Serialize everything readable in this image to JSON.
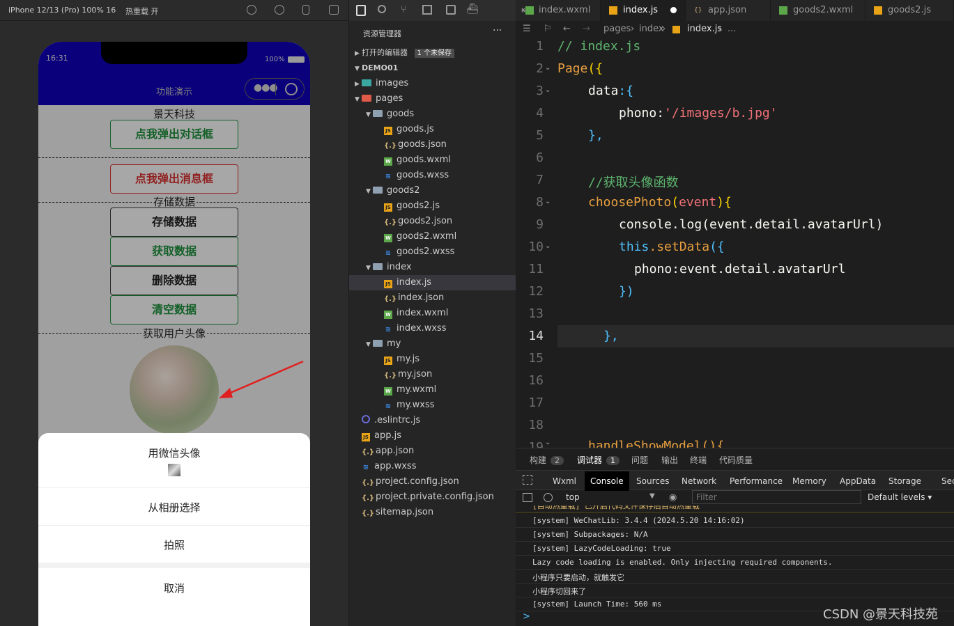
{
  "sim_toolbar": {
    "device": "iPhone 12/13 (Pro) 100% 16",
    "hot_reload": "热重载 开"
  },
  "phone": {
    "time": "16:31",
    "battery": "100%",
    "nav_title": "功能演示",
    "brand": "景天科技",
    "btn_dialog": "点我弹出对话框",
    "btn_message": "点我弹出消息框",
    "sec_storage": "存储数据",
    "btn_store": "存储数据",
    "btn_get": "获取数据",
    "btn_delete": "删除数据",
    "btn_clear": "清空数据",
    "sec_avatar": "获取用户头像",
    "sheet": {
      "item1": "用微信头像",
      "item2": "从相册选择",
      "item3": "拍照",
      "cancel": "取消"
    }
  },
  "explorer": {
    "title": "资源管理器",
    "open_editors": "打开的编辑器",
    "unsaved": "1 个未保存",
    "project": "DEMO01",
    "items": [
      {
        "label": "images",
        "indent": 1,
        "type": "folder-images",
        "open": false
      },
      {
        "label": "pages",
        "indent": 1,
        "type": "folder-pages",
        "open": true
      },
      {
        "label": "goods",
        "indent": 2,
        "type": "folder",
        "open": true
      },
      {
        "label": "goods.js",
        "indent": 3,
        "type": "js"
      },
      {
        "label": "goods.json",
        "indent": 3,
        "type": "json"
      },
      {
        "label": "goods.wxml",
        "indent": 3,
        "type": "wxml"
      },
      {
        "label": "goods.wxss",
        "indent": 3,
        "type": "wxss"
      },
      {
        "label": "goods2",
        "indent": 2,
        "type": "folder",
        "open": true
      },
      {
        "label": "goods2.js",
        "indent": 3,
        "type": "js"
      },
      {
        "label": "goods2.json",
        "indent": 3,
        "type": "json"
      },
      {
        "label": "goods2.wxml",
        "indent": 3,
        "type": "wxml"
      },
      {
        "label": "goods2.wxss",
        "indent": 3,
        "type": "wxss"
      },
      {
        "label": "index",
        "indent": 2,
        "type": "folder",
        "open": true
      },
      {
        "label": "index.js",
        "indent": 3,
        "type": "js",
        "selected": true
      },
      {
        "label": "index.json",
        "indent": 3,
        "type": "json"
      },
      {
        "label": "index.wxml",
        "indent": 3,
        "type": "wxml"
      },
      {
        "label": "index.wxss",
        "indent": 3,
        "type": "wxss"
      },
      {
        "label": "my",
        "indent": 2,
        "type": "folder",
        "open": true
      },
      {
        "label": "my.js",
        "indent": 3,
        "type": "js"
      },
      {
        "label": "my.json",
        "indent": 3,
        "type": "json"
      },
      {
        "label": "my.wxml",
        "indent": 3,
        "type": "wxml"
      },
      {
        "label": "my.wxss",
        "indent": 3,
        "type": "wxss"
      },
      {
        "label": ".eslintrc.js",
        "indent": 1,
        "type": "eslint"
      },
      {
        "label": "app.js",
        "indent": 1,
        "type": "js"
      },
      {
        "label": "app.json",
        "indent": 1,
        "type": "json"
      },
      {
        "label": "app.wxss",
        "indent": 1,
        "type": "wxss"
      },
      {
        "label": "project.config.json",
        "indent": 1,
        "type": "json"
      },
      {
        "label": "project.private.config.json",
        "indent": 1,
        "type": "json"
      },
      {
        "label": "sitemap.json",
        "indent": 1,
        "type": "json"
      }
    ]
  },
  "editor": {
    "tabs": [
      "index.wxml",
      "index.js",
      "app.json",
      "goods2.wxml",
      "goods2.js"
    ],
    "crumb": [
      "pages",
      "index",
      "index.js",
      "..."
    ],
    "lines": [
      "1",
      "2",
      "3",
      "4",
      "5",
      "6",
      "7",
      "8",
      "9",
      "10",
      "11",
      "12",
      "13",
      "14",
      "15",
      "16",
      "17",
      "18",
      "19"
    ],
    "code": {
      "l1": "// index.js",
      "l2a": "Page",
      "l2b": "({",
      "l3a": "data",
      "l3b": ":{",
      "l4a": "phono",
      ":": ":",
      "l4b": "'/images/b.jpg'",
      "l5": "},",
      "l7": "//获取头像函数",
      "l8a": "choosePhoto",
      "l8b": "(",
      "l8c": "event",
      "l8d": "){",
      "l9": "console.log(event.detail.avatarUrl)",
      "l10a": "this",
      "l10b": ".setData",
      "l10c": "({",
      "l11": "phono:event.detail.avatarUrl",
      "l12": "})",
      "l14": "},",
      "l19": "handleShowModel(){"
    }
  },
  "debug": {
    "tabs": [
      {
        "label": "构建",
        "count": "2"
      },
      {
        "label": "调试器",
        "count": "1"
      },
      {
        "label": "问题"
      },
      {
        "label": "输出"
      },
      {
        "label": "终端"
      },
      {
        "label": "代码质量"
      }
    ],
    "console_tabs": [
      "Wxml",
      "Console",
      "Sources",
      "Network",
      "Performance",
      "Memory",
      "AppData",
      "Storage",
      "Secur"
    ],
    "context": "top",
    "filter_placeholder": "Filter",
    "levels": "Default levels",
    "logs": [
      "[自动热重载] 已开启代码文件保存后自动热重载",
      "[system] WeChatLib: 3.4.4 (2024.5.20 14:16:02)",
      "[system] Subpackages: N/A",
      "[system] LazyCodeLoading: true",
      "Lazy code loading is enabled. Only injecting required components.",
      "小程序只要启动，就触发它",
      "小程序切回来了",
      "[system] Launch Time: 560 ms"
    ],
    "prompt": ">"
  },
  "watermark": "CSDN @景天科技苑"
}
